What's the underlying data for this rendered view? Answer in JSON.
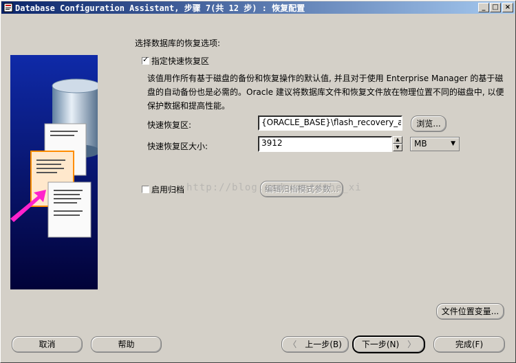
{
  "window": {
    "title": "Database Configuration Assistant, 步骤 7(共 12 步) : 恢复配置",
    "controls": {
      "minimize": "_",
      "maximize": "□",
      "close": "×"
    }
  },
  "content": {
    "heading": "选择数据库的恢复选项:",
    "flash_area_checkbox": {
      "label": "指定快速恢复区",
      "checked": true
    },
    "description": "该值用作所有基于磁盘的备份和恢复操作的默认值, 并且对于使用 Enterprise Manager 的基于磁盘的自动备份也是必需的。Oracle 建议将数据库文件和恢复文件放在物理位置不同的磁盘中, 以便保护数据和提高性能。",
    "flash_area_location": {
      "label": "快速恢复区:",
      "value": "{ORACLE_BASE}\\flash_recovery_area",
      "browse_button": "浏览..."
    },
    "flash_area_size": {
      "label": "快速恢复区大小:",
      "value": "3912",
      "unit": "MB"
    },
    "archive_checkbox": {
      "label": "启用归档",
      "checked": false
    },
    "edit_archive_button": "编辑归档模式参数...",
    "file_location_variables_button": "文件位置变量..."
  },
  "footer": {
    "cancel": "取消",
    "help": "帮助",
    "back": "上一步(B)",
    "next": "下一步(N)",
    "finish": "完成(F)"
  },
  "watermark": "http://blog.csdn.net/the_xi"
}
